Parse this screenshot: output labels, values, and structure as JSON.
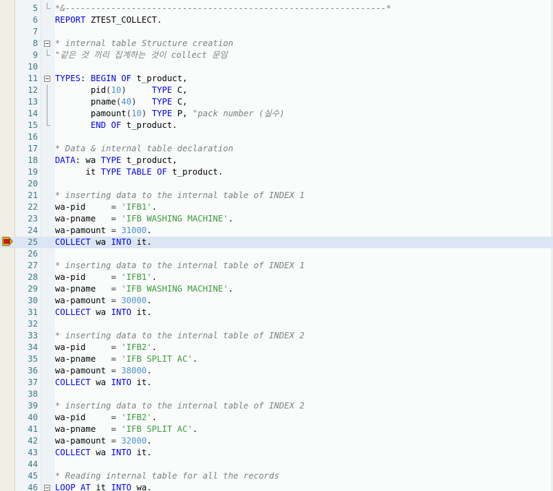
{
  "editor": {
    "current_line": 25,
    "breakpoint_line": 25,
    "lines": [
      {
        "n": "5",
        "fold": "end",
        "parts": [
          [
            "c",
            "*&---------------------------------------------------------------*"
          ]
        ]
      },
      {
        "n": "6",
        "fold": "",
        "parts": [
          [
            "k",
            "REPORT"
          ],
          [
            "t",
            " ZTEST_COLLECT."
          ]
        ]
      },
      {
        "n": "7",
        "fold": "",
        "parts": []
      },
      {
        "n": "8",
        "fold": "box",
        "parts": [
          [
            "c",
            "* internal table Structure creation"
          ]
        ]
      },
      {
        "n": "9",
        "fold": "end",
        "parts": [
          [
            "c",
            "\"같은 것 끼리 집계하는 것이 collect 문임"
          ]
        ]
      },
      {
        "n": "10",
        "fold": "",
        "parts": []
      },
      {
        "n": "11",
        "fold": "box",
        "parts": [
          [
            "k",
            "TYPES"
          ],
          [
            "t",
            ": "
          ],
          [
            "k",
            "BEGIN OF"
          ],
          [
            "t",
            " t_product,"
          ]
        ]
      },
      {
        "n": "12",
        "fold": "pipe",
        "parts": [
          [
            "t",
            "       pid"
          ],
          [
            "p",
            "("
          ],
          [
            "n",
            "10"
          ],
          [
            "p",
            ")"
          ],
          [
            "t",
            "     "
          ],
          [
            "k",
            "TYPE"
          ],
          [
            "t",
            " C,"
          ]
        ]
      },
      {
        "n": "13",
        "fold": "pipe",
        "parts": [
          [
            "t",
            "       pname"
          ],
          [
            "p",
            "("
          ],
          [
            "n",
            "40"
          ],
          [
            "p",
            ")"
          ],
          [
            "t",
            "   "
          ],
          [
            "k",
            "TYPE"
          ],
          [
            "t",
            " C,"
          ]
        ]
      },
      {
        "n": "14",
        "fold": "pipe",
        "parts": [
          [
            "t",
            "       pamount"
          ],
          [
            "p",
            "("
          ],
          [
            "n",
            "10"
          ],
          [
            "p",
            ")"
          ],
          [
            "t",
            " "
          ],
          [
            "k",
            "TYPE"
          ],
          [
            "t",
            " P, "
          ],
          [
            "c",
            "\"pack number (실수)"
          ]
        ]
      },
      {
        "n": "15",
        "fold": "end",
        "parts": [
          [
            "t",
            "       "
          ],
          [
            "k",
            "END OF"
          ],
          [
            "t",
            " t_product."
          ]
        ]
      },
      {
        "n": "16",
        "fold": "",
        "parts": []
      },
      {
        "n": "17",
        "fold": "",
        "parts": [
          [
            "c",
            "* Data & internal table declaration"
          ]
        ]
      },
      {
        "n": "18",
        "fold": "",
        "parts": [
          [
            "k",
            "DATA"
          ],
          [
            "t",
            ": wa "
          ],
          [
            "k",
            "TYPE"
          ],
          [
            "t",
            " t_product,"
          ]
        ]
      },
      {
        "n": "19",
        "fold": "",
        "parts": [
          [
            "t",
            "      it "
          ],
          [
            "k",
            "TYPE TABLE OF"
          ],
          [
            "t",
            " t_product."
          ]
        ]
      },
      {
        "n": "20",
        "fold": "",
        "parts": []
      },
      {
        "n": "21",
        "fold": "",
        "parts": [
          [
            "c",
            "* inserting data to the internal table of INDEX 1"
          ]
        ]
      },
      {
        "n": "22",
        "fold": "",
        "parts": [
          [
            "t",
            "wa-pid     "
          ],
          [
            "p",
            "= "
          ],
          [
            "s",
            "'IFB1'"
          ],
          [
            "t",
            "."
          ]
        ]
      },
      {
        "n": "23",
        "fold": "",
        "parts": [
          [
            "t",
            "wa-pname   "
          ],
          [
            "p",
            "= "
          ],
          [
            "s",
            "'IFB WASHING MACHINE'"
          ],
          [
            "t",
            "."
          ]
        ]
      },
      {
        "n": "24",
        "fold": "",
        "parts": [
          [
            "t",
            "wa-pamount "
          ],
          [
            "p",
            "= "
          ],
          [
            "n",
            "31000"
          ],
          [
            "t",
            "."
          ]
        ]
      },
      {
        "n": "25",
        "fold": "",
        "parts": [
          [
            "k",
            "COLLECT"
          ],
          [
            "t",
            " wa "
          ],
          [
            "k",
            "INTO"
          ],
          [
            "t",
            " it."
          ]
        ]
      },
      {
        "n": "26",
        "fold": "",
        "parts": []
      },
      {
        "n": "27",
        "fold": "",
        "parts": [
          [
            "c",
            "* inserting data to the internal table of INDEX 1"
          ]
        ]
      },
      {
        "n": "28",
        "fold": "",
        "parts": [
          [
            "t",
            "wa-pid     "
          ],
          [
            "p",
            "= "
          ],
          [
            "s",
            "'IFB1'"
          ],
          [
            "t",
            "."
          ]
        ]
      },
      {
        "n": "29",
        "fold": "",
        "parts": [
          [
            "t",
            "wa-pname   "
          ],
          [
            "p",
            "= "
          ],
          [
            "s",
            "'IFB WASHING MACHINE'"
          ],
          [
            "t",
            "."
          ]
        ]
      },
      {
        "n": "30",
        "fold": "",
        "parts": [
          [
            "t",
            "wa-pamount "
          ],
          [
            "p",
            "= "
          ],
          [
            "n",
            "30000"
          ],
          [
            "t",
            "."
          ]
        ]
      },
      {
        "n": "31",
        "fold": "",
        "parts": [
          [
            "k",
            "COLLECT"
          ],
          [
            "t",
            " wa "
          ],
          [
            "k",
            "INTO"
          ],
          [
            "t",
            " it."
          ]
        ]
      },
      {
        "n": "32",
        "fold": "",
        "parts": []
      },
      {
        "n": "33",
        "fold": "",
        "parts": [
          [
            "c",
            "* inserting data to the internal table of INDEX 2"
          ]
        ]
      },
      {
        "n": "34",
        "fold": "",
        "parts": [
          [
            "t",
            "wa-pid     "
          ],
          [
            "p",
            "= "
          ],
          [
            "s",
            "'IFB2'"
          ],
          [
            "t",
            "."
          ]
        ]
      },
      {
        "n": "35",
        "fold": "",
        "parts": [
          [
            "t",
            "wa-pname   "
          ],
          [
            "p",
            "= "
          ],
          [
            "s",
            "'IFB SPLIT AC'"
          ],
          [
            "t",
            "."
          ]
        ]
      },
      {
        "n": "36",
        "fold": "",
        "parts": [
          [
            "t",
            "wa-pamount "
          ],
          [
            "p",
            "= "
          ],
          [
            "n",
            "38000"
          ],
          [
            "t",
            "."
          ]
        ]
      },
      {
        "n": "37",
        "fold": "",
        "parts": [
          [
            "k",
            "COLLECT"
          ],
          [
            "t",
            " wa "
          ],
          [
            "k",
            "INTO"
          ],
          [
            "t",
            " it."
          ]
        ]
      },
      {
        "n": "38",
        "fold": "",
        "parts": []
      },
      {
        "n": "39",
        "fold": "",
        "parts": [
          [
            "c",
            "* inserting data to the internal table of INDEX 2"
          ]
        ]
      },
      {
        "n": "40",
        "fold": "",
        "parts": [
          [
            "t",
            "wa-pid     "
          ],
          [
            "p",
            "= "
          ],
          [
            "s",
            "'IFB2'"
          ],
          [
            "t",
            "."
          ]
        ]
      },
      {
        "n": "41",
        "fold": "",
        "parts": [
          [
            "t",
            "wa-pname   "
          ],
          [
            "p",
            "= "
          ],
          [
            "s",
            "'IFB SPLIT AC'"
          ],
          [
            "t",
            "."
          ]
        ]
      },
      {
        "n": "42",
        "fold": "",
        "parts": [
          [
            "t",
            "wa-pamount "
          ],
          [
            "p",
            "= "
          ],
          [
            "n",
            "32000"
          ],
          [
            "t",
            "."
          ]
        ]
      },
      {
        "n": "43",
        "fold": "",
        "parts": [
          [
            "k",
            "COLLECT"
          ],
          [
            "t",
            " wa "
          ],
          [
            "k",
            "INTO"
          ],
          [
            "t",
            " it."
          ]
        ]
      },
      {
        "n": "44",
        "fold": "",
        "parts": []
      },
      {
        "n": "45",
        "fold": "",
        "parts": [
          [
            "c",
            "* Reading internal table for all the records"
          ]
        ]
      },
      {
        "n": "46",
        "fold": "box",
        "parts": [
          [
            "k",
            "LOOP AT"
          ],
          [
            "t",
            " it "
          ],
          [
            "k",
            "INTO"
          ],
          [
            "t",
            " wa."
          ]
        ]
      }
    ]
  }
}
